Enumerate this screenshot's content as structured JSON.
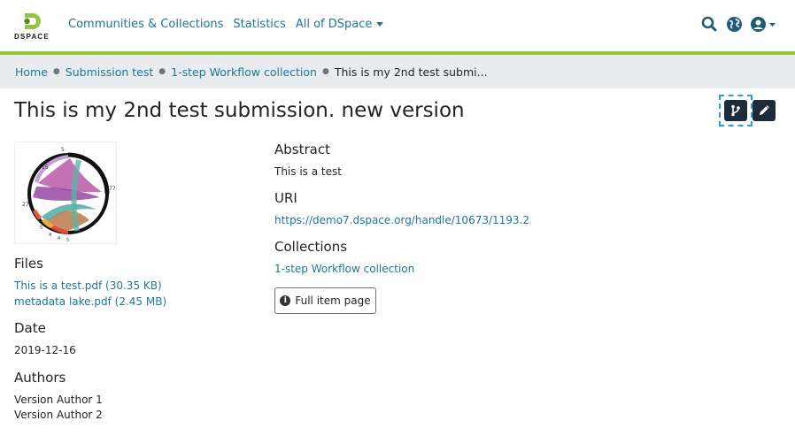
{
  "header": {
    "logo_text": "DSPACE",
    "nav": {
      "communities": "Communities & Collections",
      "statistics": "Statistics",
      "all_dspace": "All of DSpace"
    },
    "colors": {
      "accent": "#92c642",
      "link": "#207698",
      "button_dark": "#1d2b3a"
    }
  },
  "breadcrumb": {
    "home": "Home",
    "submission": "Submission test",
    "collection": "1-step Workflow collection",
    "current": "This is my 2nd test submi..."
  },
  "item": {
    "title": "This is my 2nd test submission. new version",
    "files": {
      "heading": "Files",
      "list": [
        "This is a test.pdf (30.35 KB)",
        "metadata lake.pdf (2.45 MB)"
      ]
    },
    "date": {
      "heading": "Date",
      "value": "2019-12-16"
    },
    "authors": {
      "heading": "Authors",
      "list": [
        "Version Author 1",
        "Version Author 2"
      ]
    },
    "abstract": {
      "heading": "Abstract",
      "value": "This is a test"
    },
    "uri": {
      "heading": "URI",
      "value": "https://demo7.dspace.org/handle/10673/1193.2"
    },
    "collections": {
      "heading": "Collections",
      "value": "1-step Workflow collection"
    },
    "full_item_label": "Full item page"
  },
  "icons": {
    "search": "search-icon",
    "language": "globe-icon",
    "user": "user-circle-icon",
    "version": "code-branch-icon",
    "edit": "pencil-icon",
    "info": "info-circle-icon"
  },
  "thumbnail_labels": [
    "5",
    "15",
    "77",
    "27",
    "5",
    "4",
    "4",
    "5"
  ]
}
